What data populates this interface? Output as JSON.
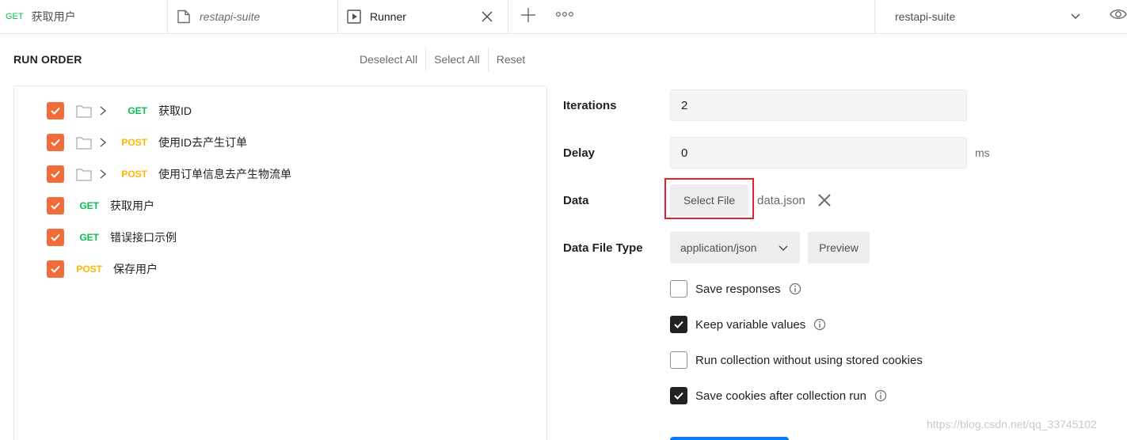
{
  "tabs": {
    "get_tab": {
      "method": "GET",
      "title": "获取用户"
    },
    "collection_tab": {
      "title": "restapi-suite"
    },
    "runner_tab": {
      "title": "Runner"
    }
  },
  "environment": {
    "selected": "restapi-suite"
  },
  "run_order": {
    "title": "RUN ORDER",
    "deselect_all": "Deselect All",
    "select_all": "Select All",
    "reset": "Reset",
    "items": [
      {
        "method": "GET",
        "name": "获取ID",
        "folder": true,
        "checked": true
      },
      {
        "method": "POST",
        "name": "使用ID去产生订单",
        "folder": true,
        "checked": true
      },
      {
        "method": "POST",
        "name": "使用订单信息去产生物流单",
        "folder": true,
        "checked": true
      },
      {
        "method": "GET",
        "name": "获取用户",
        "folder": false,
        "checked": true
      },
      {
        "method": "GET",
        "name": "错误接口示例",
        "folder": false,
        "checked": true
      },
      {
        "method": "POST",
        "name": "保存用户",
        "folder": false,
        "checked": true
      }
    ]
  },
  "settings": {
    "iterations_label": "Iterations",
    "iterations_value": "2",
    "delay_label": "Delay",
    "delay_value": "0",
    "delay_unit": "ms",
    "data_label": "Data",
    "select_file_label": "Select File",
    "file_name": "data.json",
    "data_file_type_label": "Data File Type",
    "data_file_type_value": "application/json",
    "preview_label": "Preview",
    "options": [
      {
        "label": "Save responses",
        "checked": false,
        "info": true
      },
      {
        "label": "Keep variable values",
        "checked": true,
        "info": true
      },
      {
        "label": "Run collection without using stored cookies",
        "checked": false,
        "info": false
      },
      {
        "label": "Save cookies after collection run",
        "checked": true,
        "info": true
      }
    ]
  },
  "watermark": "https://blog.csdn.net/qq_33745102",
  "colors": {
    "checkbox_orange": "#f26b3a",
    "get_green": "#0cbb52",
    "post_yellow": "#ffb400",
    "highlight_red": "#e8202a",
    "run_blue": "#097bed"
  }
}
